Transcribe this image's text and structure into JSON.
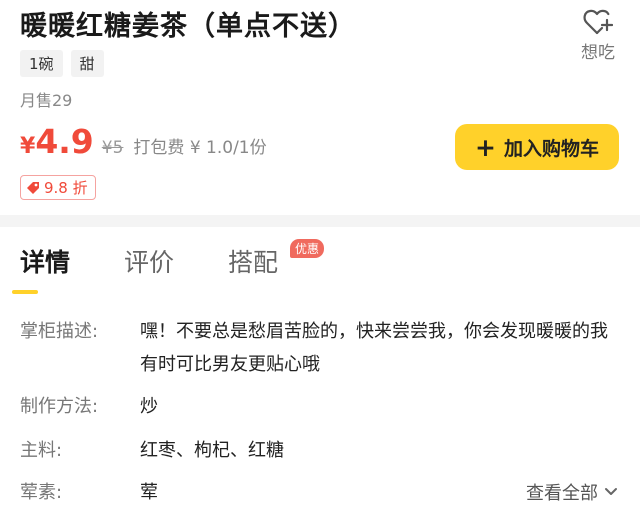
{
  "product": {
    "title": "暖暖红糖姜茶（单点不送）",
    "tags": [
      "1碗",
      "甜"
    ],
    "monthly_sales": "月售29",
    "currency": "¥",
    "price": "4.9",
    "original_price": "¥5",
    "packing_fee": "打包费 ¥ 1.0/1份",
    "discount": "9.8 折"
  },
  "favorite": {
    "label": "想吃",
    "icon": "heart-plus-icon"
  },
  "cart_button": {
    "label": "加入购物车",
    "icon": "plus-icon"
  },
  "tabs": [
    {
      "label": "详情",
      "active": true
    },
    {
      "label": "评价",
      "active": false
    },
    {
      "label": "搭配",
      "active": false
    }
  ],
  "promo_badge": "优惠",
  "details": [
    {
      "key": "掌柜描述:",
      "value": "嘿！不要总是愁眉苦脸的，快来尝尝我，你会发现暖暖的我有时可比男友更贴心哦"
    },
    {
      "key": "制作方法:",
      "value": "炒"
    },
    {
      "key": "主料:",
      "value": "红枣、枸杞、红糖"
    },
    {
      "key": "荤素:",
      "value": "荤"
    }
  ],
  "see_all": "查看全部",
  "colors": {
    "accent": "#ffd12a",
    "price": "#f04a3a",
    "promo": "#f06a5e"
  }
}
